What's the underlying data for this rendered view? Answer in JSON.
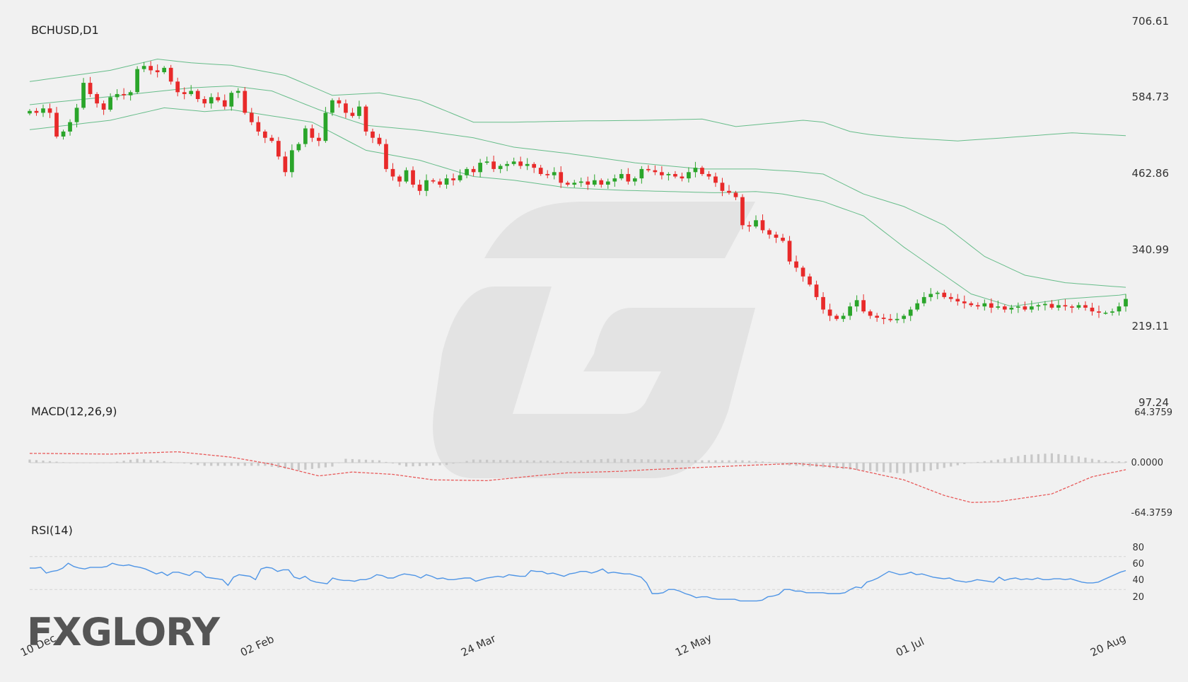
{
  "chart_data": [
    {
      "type": "candlestick",
      "title": "BCHUSD,D1",
      "overlay": "Bollinger Bands",
      "ylim": [
        97.24,
        706.61
      ],
      "y_ticks": [
        "706.61",
        "584.73",
        "462.86",
        "340.99",
        "219.11",
        "97.24"
      ],
      "x_tick_labels": [
        "10 Dec",
        "02 Feb",
        "24 Mar",
        "12 May",
        "01 Jul",
        "20 Aug"
      ],
      "close_series": [
        563,
        560,
        567,
        560,
        522,
        530,
        545,
        568,
        608,
        590,
        575,
        565,
        585,
        590,
        588,
        593,
        630,
        635,
        628,
        625,
        632,
        610,
        593,
        590,
        595,
        582,
        575,
        585,
        580,
        570,
        592,
        595,
        560,
        545,
        530,
        520,
        515,
        490,
        465,
        500,
        510,
        535,
        520,
        515,
        560,
        580,
        575,
        560,
        555,
        570,
        530,
        520,
        510,
        470,
        458,
        450,
        468,
        445,
        435,
        452,
        450,
        445,
        455,
        452,
        460,
        470,
        465,
        480,
        482,
        470,
        475,
        478,
        482,
        475,
        478,
        472,
        462,
        460,
        465,
        448,
        445,
        448,
        450,
        445,
        452,
        445,
        450,
        455,
        462,
        450,
        455,
        470,
        468,
        465,
        460,
        462,
        458,
        455,
        465,
        472,
        462,
        458,
        448,
        435,
        432,
        425,
        380,
        378,
        388,
        372,
        365,
        360,
        355,
        322,
        312,
        298,
        285,
        265,
        245,
        235,
        230,
        235,
        250,
        260,
        242,
        235,
        232,
        230,
        228,
        230,
        235,
        245,
        255,
        265,
        270,
        272,
        265,
        262,
        258,
        255,
        252,
        250,
        255,
        248,
        250,
        245,
        248,
        250,
        245,
        250,
        252,
        254,
        248,
        252,
        250,
        248,
        252,
        248,
        242,
        240,
        240,
        242,
        250,
        262
      ],
      "band_upper_anchor_points": [
        [
          0,
          610
        ],
        [
          12,
          628
        ],
        [
          19,
          646
        ],
        [
          24,
          640
        ],
        [
          30,
          636
        ],
        [
          38,
          620
        ],
        [
          45,
          588
        ],
        [
          52,
          592
        ],
        [
          58,
          580
        ],
        [
          66,
          545
        ],
        [
          72,
          545
        ],
        [
          82,
          547
        ],
        [
          92,
          548
        ],
        [
          100,
          550
        ],
        [
          105,
          538
        ],
        [
          110,
          543
        ],
        [
          115,
          548
        ],
        [
          118,
          545
        ],
        [
          122,
          530
        ],
        [
          125,
          525
        ],
        [
          130,
          520
        ],
        [
          138,
          515
        ],
        [
          145,
          520
        ],
        [
          150,
          524
        ],
        [
          155,
          528
        ],
        [
          160,
          525
        ],
        [
          170,
          520
        ],
        [
          175,
          480
        ]
      ],
      "band_middle_anchor_points": [
        [
          0,
          573
        ],
        [
          12,
          586
        ],
        [
          24,
          600
        ],
        [
          30,
          603
        ],
        [
          36,
          595
        ],
        [
          43,
          565
        ],
        [
          50,
          540
        ],
        [
          58,
          532
        ],
        [
          66,
          520
        ],
        [
          72,
          505
        ],
        [
          80,
          495
        ],
        [
          90,
          480
        ],
        [
          100,
          470
        ],
        [
          108,
          470
        ],
        [
          114,
          466
        ],
        [
          118,
          462
        ],
        [
          124,
          430
        ],
        [
          130,
          410
        ],
        [
          136,
          380
        ],
        [
          142,
          330
        ],
        [
          148,
          300
        ],
        [
          154,
          288
        ],
        [
          160,
          283
        ],
        [
          170,
          275
        ],
        [
          175,
          270
        ]
      ],
      "band_lower_anchor_points": [
        [
          0,
          533
        ],
        [
          12,
          548
        ],
        [
          20,
          568
        ],
        [
          26,
          562
        ],
        [
          30,
          565
        ],
        [
          36,
          555
        ],
        [
          42,
          545
        ],
        [
          50,
          500
        ],
        [
          58,
          484
        ],
        [
          66,
          458
        ],
        [
          72,
          452
        ],
        [
          80,
          440
        ],
        [
          88,
          436
        ],
        [
          95,
          434
        ],
        [
          102,
          432
        ],
        [
          108,
          434
        ],
        [
          112,
          430
        ],
        [
          118,
          418
        ],
        [
          124,
          395
        ],
        [
          130,
          345
        ],
        [
          136,
          300
        ],
        [
          140,
          270
        ],
        [
          146,
          250
        ],
        [
          154,
          262
        ],
        [
          162,
          268
        ],
        [
          170,
          280
        ],
        [
          175,
          285
        ]
      ]
    },
    {
      "type": "macd",
      "title": "MACD(12,26,9)",
      "ylim": [
        -64.3759,
        64.3759
      ],
      "y_ticks": [
        "64.3759",
        "0.0000",
        "-64.3759"
      ],
      "signal_anchor_points": [
        [
          0,
          12
        ],
        [
          12,
          11
        ],
        [
          22,
          14
        ],
        [
          30,
          7
        ],
        [
          36,
          -2
        ],
        [
          43,
          -17
        ],
        [
          48,
          -12
        ],
        [
          54,
          -15
        ],
        [
          60,
          -22
        ],
        [
          68,
          -23
        ],
        [
          75,
          -17
        ],
        [
          80,
          -13
        ],
        [
          88,
          -11
        ],
        [
          92,
          -9
        ],
        [
          100,
          -6
        ],
        [
          108,
          -3
        ],
        [
          114,
          -1
        ],
        [
          122,
          -7
        ],
        [
          130,
          -22
        ],
        [
          136,
          -42
        ],
        [
          140,
          -51
        ],
        [
          144,
          -50
        ],
        [
          152,
          -40
        ],
        [
          158,
          -18
        ],
        [
          163,
          -9
        ],
        [
          170,
          -6
        ],
        [
          175,
          -6
        ]
      ],
      "histogram_anchor_points": [
        [
          0,
          4
        ],
        [
          6,
          0
        ],
        [
          12,
          0
        ],
        [
          16,
          5
        ],
        [
          20,
          2
        ],
        [
          26,
          -4
        ],
        [
          35,
          -4
        ],
        [
          40,
          -10
        ],
        [
          45,
          -5
        ],
        [
          47,
          5
        ],
        [
          52,
          3
        ],
        [
          56,
          -5
        ],
        [
          62,
          -3
        ],
        [
          66,
          4
        ],
        [
          74,
          3
        ],
        [
          80,
          2
        ],
        [
          86,
          5
        ],
        [
          94,
          4
        ],
        [
          100,
          3
        ],
        [
          106,
          3
        ],
        [
          110,
          1
        ],
        [
          112,
          -3
        ],
        [
          118,
          -6
        ],
        [
          124,
          -10
        ],
        [
          130,
          -14
        ],
        [
          134,
          -10
        ],
        [
          140,
          0
        ],
        [
          144,
          4
        ],
        [
          148,
          10
        ],
        [
          152,
          12
        ],
        [
          156,
          8
        ],
        [
          160,
          2
        ],
        [
          175,
          0
        ]
      ]
    },
    {
      "type": "rsi",
      "title": "RSI(14)",
      "ylim": [
        0,
        100
      ],
      "y_ticks": [
        "80",
        "60",
        "40",
        "20"
      ],
      "levels": [
        70,
        30
      ],
      "values": [
        56,
        56,
        57,
        50,
        52,
        53,
        56,
        62,
        58,
        56,
        55,
        57,
        57,
        57,
        58,
        62,
        60,
        59,
        60,
        58,
        57,
        55,
        52,
        49,
        51,
        47,
        51,
        51,
        49,
        47,
        52,
        51,
        45,
        44,
        43,
        42,
        35,
        45,
        48,
        47,
        46,
        42,
        55,
        57,
        56,
        52,
        54,
        54,
        45,
        43,
        46,
        41,
        39,
        38,
        37,
        44,
        42,
        41,
        41,
        40,
        42,
        42,
        44,
        48,
        47,
        44,
        44,
        47,
        49,
        48,
        47,
        44,
        48,
        46,
        43,
        44,
        42,
        42,
        43,
        44,
        44,
        40,
        42,
        44,
        45,
        46,
        45,
        48,
        47,
        46,
        46,
        53,
        52,
        52,
        49,
        50,
        48,
        46,
        49,
        50,
        52,
        52,
        50,
        52,
        55,
        50,
        51,
        50,
        49,
        49,
        47,
        45,
        38,
        25,
        25,
        26,
        30,
        30,
        28,
        25,
        23,
        20,
        21,
        21,
        19,
        18,
        18,
        18,
        18,
        16,
        16,
        16,
        16,
        17,
        21,
        22,
        24,
        30,
        30,
        28,
        28,
        26,
        26,
        26,
        26,
        25,
        25,
        25,
        26,
        30,
        33,
        32,
        39,
        41,
        44,
        48,
        52,
        50,
        48,
        49,
        51,
        48,
        49,
        47,
        45,
        44,
        43,
        44,
        41,
        40,
        39,
        40,
        42,
        41,
        40,
        39,
        45,
        41,
        43,
        44,
        42,
        43,
        42,
        44,
        42,
        42,
        43,
        43,
        42,
        43,
        41,
        39,
        38,
        38,
        39,
        42,
        45,
        48,
        51,
        53
      ]
    }
  ],
  "watermark_logo": {
    "text": "FXGLORY",
    "accent": "#e8722a"
  },
  "colors": {
    "bull": "#2aa52a",
    "bear": "#e82a2a",
    "band": "#67bd8a",
    "macd_signal": "#e85a5a",
    "macd_hist": "#c8c8c8",
    "rsi": "#4f95e6",
    "watermark": "#e3e3e3",
    "text": "#333333"
  }
}
